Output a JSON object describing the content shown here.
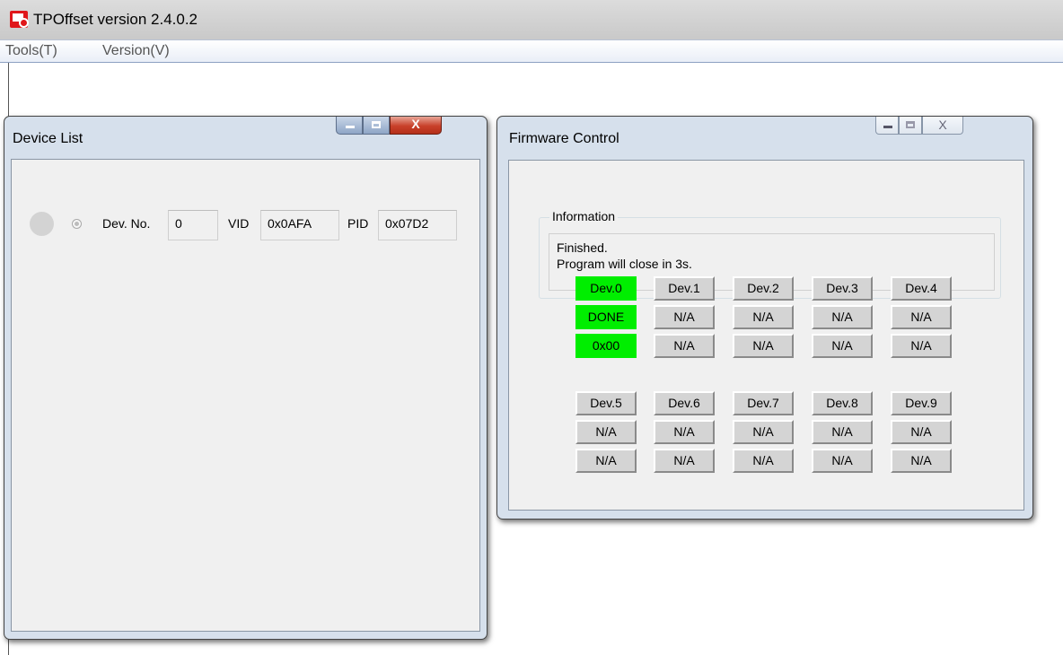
{
  "app": {
    "title": "TPOffset version 2.4.0.2",
    "icon": "app-icon"
  },
  "menu": {
    "items": [
      "Tools(T)",
      "Version(V)"
    ]
  },
  "device_list": {
    "title": "Device List",
    "close_glyph": "X",
    "device": {
      "no_label": "Dev. No.",
      "no_value": "0",
      "vid_label": "VID",
      "vid_value": "0x0AFA",
      "pid_label": "PID",
      "pid_value": "0x07D2"
    }
  },
  "firmware_control": {
    "title": "Firmware Control",
    "close_glyph": "X",
    "information": {
      "label": "Information",
      "line1": "Finished.",
      "line2": "Program will close in 3s."
    },
    "devices": [
      {
        "name": "Dev.0",
        "status": "DONE",
        "code": "0x00",
        "done": true
      },
      {
        "name": "Dev.1",
        "status": "N/A",
        "code": "N/A",
        "done": false
      },
      {
        "name": "Dev.2",
        "status": "N/A",
        "code": "N/A",
        "done": false
      },
      {
        "name": "Dev.3",
        "status": "N/A",
        "code": "N/A",
        "done": false
      },
      {
        "name": "Dev.4",
        "status": "N/A",
        "code": "N/A",
        "done": false
      },
      {
        "name": "Dev.5",
        "status": "N/A",
        "code": "N/A",
        "done": false
      },
      {
        "name": "Dev.6",
        "status": "N/A",
        "code": "N/A",
        "done": false
      },
      {
        "name": "Dev.7",
        "status": "N/A",
        "code": "N/A",
        "done": false
      },
      {
        "name": "Dev.8",
        "status": "N/A",
        "code": "N/A",
        "done": false
      },
      {
        "name": "Dev.9",
        "status": "N/A",
        "code": "N/A",
        "done": false
      }
    ]
  },
  "colors": {
    "done": "#00ee00",
    "cell": "#d4d4d4",
    "close_button": "#c8402a"
  }
}
